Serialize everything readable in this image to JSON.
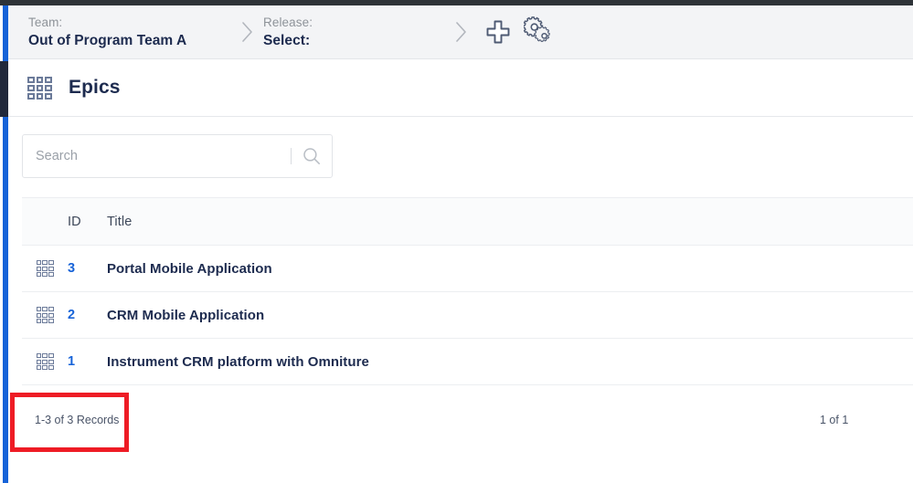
{
  "colors": {
    "top_bar": "#2e3338",
    "rail_blue": "#1763d8",
    "rail_dark": "#21293b",
    "band_gray": "#f3f4f6",
    "accent_blue": "#1763d8",
    "text_navy": "#1d2b4f",
    "annotation_red": "#ee1c25"
  },
  "breadcrumb": {
    "team": {
      "label": "Team:",
      "value": "Out of Program Team A"
    },
    "release": {
      "label": "Release:",
      "value": "Select:"
    },
    "separator_icon": "chevron-right-icon"
  },
  "toolbar": {
    "add_icon": "plus-icon",
    "settings_icon": "gears-icon"
  },
  "page": {
    "icon": "grid-icon",
    "title": "Epics"
  },
  "search": {
    "placeholder": "Search",
    "value": "",
    "icon": "search-icon"
  },
  "table": {
    "columns": [
      "ID",
      "Title"
    ],
    "rows": [
      {
        "icon": "grid-icon",
        "id": "3",
        "title": "Portal Mobile Application"
      },
      {
        "icon": "grid-icon",
        "id": "2",
        "title": "CRM Mobile Application"
      },
      {
        "icon": "grid-icon",
        "id": "1",
        "title": "Instrument CRM platform with Omniture"
      }
    ]
  },
  "footer": {
    "records": "1-3 of 3 Records",
    "page": "1 of 1"
  }
}
